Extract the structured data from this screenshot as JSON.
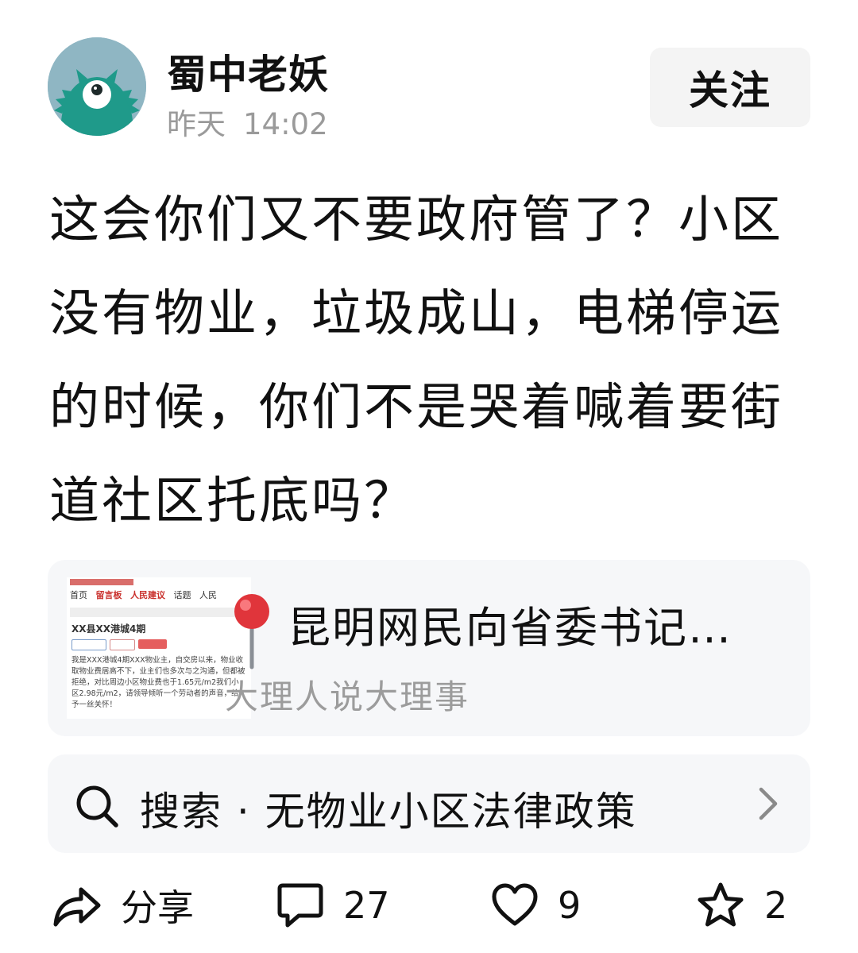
{
  "author": {
    "name": "蜀中老妖",
    "date": "昨天",
    "time": "14:02",
    "avatar_icon": "teal-one-eyed-monster-avatar"
  },
  "follow_button": {
    "label": "关注"
  },
  "post": {
    "text": "这会你们又不要政府管了？小区没有物业，垃圾成山，电梯停运的时候，你们不是哭着喊着要街道社区托底吗？"
  },
  "link_card": {
    "icon": "round-pushpin",
    "title": "昆明网民向省委书记…",
    "source": "大理人说大理事",
    "thumbnail": {
      "nav_items": [
        "首页",
        "留言板",
        "人民建议",
        "话题",
        "人民"
      ],
      "heading": "XX县XX港城4期",
      "body": "我是XXX港城4期XXX物业主，自交房以来，物业收取物业费居高不下，业主们也多次与之沟通，但都被拒绝，对比周边小区物业费也于1.65元/m2我们小区2.98元/m2，请领导倾听一个劳动者的声音，给予一丝关怀！"
    }
  },
  "search": {
    "label": "搜索 · 无物业小区法律政策"
  },
  "actions": {
    "share_label": "分享",
    "comment_count": "27",
    "like_count": "9",
    "favorite_count": "2"
  },
  "colors": {
    "background": "#ffffff",
    "card_background": "#f6f7f9",
    "button_background": "#f4f4f4",
    "secondary_text": "#9a9a9a",
    "avatar_teal": "#1f9a8a",
    "avatar_bg": "#8fb6c3",
    "pin_red": "#e0353b"
  }
}
